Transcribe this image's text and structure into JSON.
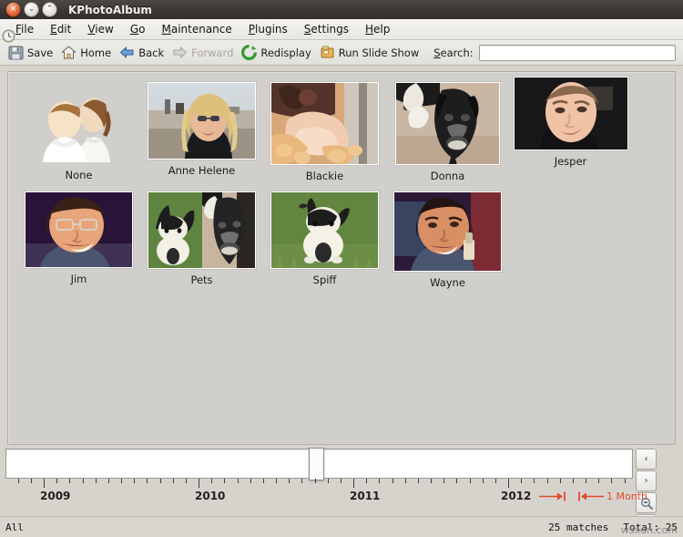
{
  "window": {
    "title": "KPhotoAlbum",
    "buttons": [
      {
        "name": "close",
        "glyph": "×"
      },
      {
        "name": "minimize",
        "glyph": "⌄"
      },
      {
        "name": "maximize",
        "glyph": "⌃"
      }
    ]
  },
  "menubar": {
    "items": [
      {
        "label": "File",
        "mnemonic": "F"
      },
      {
        "label": "Edit",
        "mnemonic": "E"
      },
      {
        "label": "View",
        "mnemonic": "V"
      },
      {
        "label": "Go",
        "mnemonic": "G"
      },
      {
        "label": "Maintenance",
        "mnemonic": "M"
      },
      {
        "label": "Plugins",
        "mnemonic": "P"
      },
      {
        "label": "Settings",
        "mnemonic": "S"
      },
      {
        "label": "Help",
        "mnemonic": "H"
      }
    ]
  },
  "toolbar": {
    "buttons": [
      {
        "label": "Save",
        "icon": "floppy-disk-icon",
        "enabled": true
      },
      {
        "label": "Home",
        "icon": "home-icon",
        "enabled": true
      },
      {
        "label": "Back",
        "icon": "arrow-left-icon",
        "enabled": true
      },
      {
        "label": "Forward",
        "icon": "arrow-right-icon",
        "enabled": false
      },
      {
        "label": "Redisplay",
        "icon": "refresh-icon",
        "enabled": true
      },
      {
        "label": "Run Slide Show",
        "icon": "slideshow-icon",
        "enabled": true
      }
    ],
    "search_label": "Search:",
    "search_value": "",
    "search_placeholder": ""
  },
  "browser": {
    "rows": [
      [
        {
          "label": "None",
          "image": "people-placeholder"
        },
        {
          "label": "Anne Helene",
          "image": "woman-beach-photo"
        },
        {
          "label": "Blackie",
          "image": "rabbit-closeup-photo"
        },
        {
          "label": "Donna",
          "image": "black-dog-photo"
        },
        {
          "label": "Jesper",
          "image": "man-dark-shirt-photo"
        }
      ],
      [
        {
          "label": "Jim",
          "image": "man-glasses-photo"
        },
        {
          "label": "Pets",
          "image": "rabbit-and-dog-photo"
        },
        {
          "label": "Spiff",
          "image": "rabbit-grass-photo"
        },
        {
          "label": "Wayne",
          "image": "man-smiling-photo"
        }
      ]
    ]
  },
  "timeline": {
    "years": [
      "2009",
      "2010",
      "2011",
      "2012"
    ],
    "granularity": "1 Month",
    "nav_prev": "‹",
    "nav_next": "›",
    "zoom_out": "zoom-out-icon",
    "zoom_in": "zoom-in-icon",
    "clock_icon": "clock-icon"
  },
  "statusbar": {
    "left": "All",
    "matches": "25 matches",
    "total": "Total: 25",
    "watermark": "wsxdn.com"
  },
  "colors": {
    "titlebar": "#3a3633",
    "window_bg": "#d6d3cd",
    "browser_bg": "#d0cfcb",
    "accent_red": "#e0492e",
    "close_button": "#e0683a"
  }
}
